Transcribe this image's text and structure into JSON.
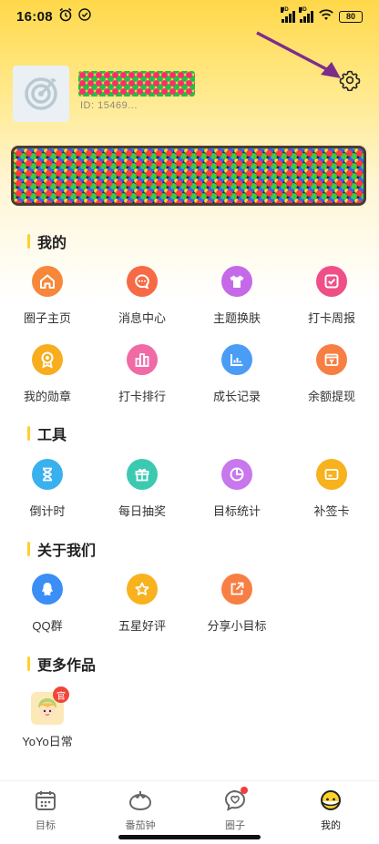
{
  "status": {
    "time": "16:08",
    "battery": "80"
  },
  "profile": {
    "user_id": "ID: 15469..."
  },
  "sections": {
    "mine": {
      "title": "我的",
      "items": [
        {
          "label": "圈子主页",
          "icon": "home-icon",
          "color": "#f7873b"
        },
        {
          "label": "消息中心",
          "icon": "message-icon",
          "color": "#f66a45"
        },
        {
          "label": "主题换肤",
          "icon": "tshirt-icon",
          "color": "#c569e8"
        },
        {
          "label": "打卡周报",
          "icon": "check-square-icon",
          "color": "#ef4f86"
        },
        {
          "label": "我的勋章",
          "icon": "medal-icon",
          "color": "#f7ad1e"
        },
        {
          "label": "打卡排行",
          "icon": "bar-chart-icon",
          "color": "#f06aa6"
        },
        {
          "label": "成长记录",
          "icon": "growth-chart-icon",
          "color": "#4a9cf5"
        },
        {
          "label": "余额提现",
          "icon": "wallet-icon",
          "color": "#f77f44"
        }
      ]
    },
    "tools": {
      "title": "工具",
      "items": [
        {
          "label": "倒计时",
          "icon": "hourglass-icon",
          "color": "#39b1ef"
        },
        {
          "label": "每日抽奖",
          "icon": "gift-icon",
          "color": "#3bc9b2"
        },
        {
          "label": "目标统计",
          "icon": "pie-chart-icon",
          "color": "#c877ec"
        },
        {
          "label": "补签卡",
          "icon": "card-icon",
          "color": "#f7b21e"
        }
      ]
    },
    "about": {
      "title": "关于我们",
      "items": [
        {
          "label": "QQ群",
          "icon": "qq-icon",
          "color": "#3a8ef5"
        },
        {
          "label": "五星好评",
          "icon": "star-icon",
          "color": "#f7b21e"
        },
        {
          "label": "分享小目标",
          "icon": "share-icon",
          "color": "#f77f44"
        }
      ]
    },
    "more": {
      "title": "更多作品",
      "apps": [
        {
          "label": "YoYo日常",
          "badge": "官"
        }
      ]
    }
  },
  "tabbar": [
    {
      "label": "目标",
      "icon": "calendar-icon",
      "active": false
    },
    {
      "label": "番茄钟",
      "icon": "tomato-icon",
      "active": false
    },
    {
      "label": "圈子",
      "icon": "chat-bubble-icon",
      "active": false
    },
    {
      "label": "我的",
      "icon": "profile-face-icon",
      "active": true
    }
  ]
}
